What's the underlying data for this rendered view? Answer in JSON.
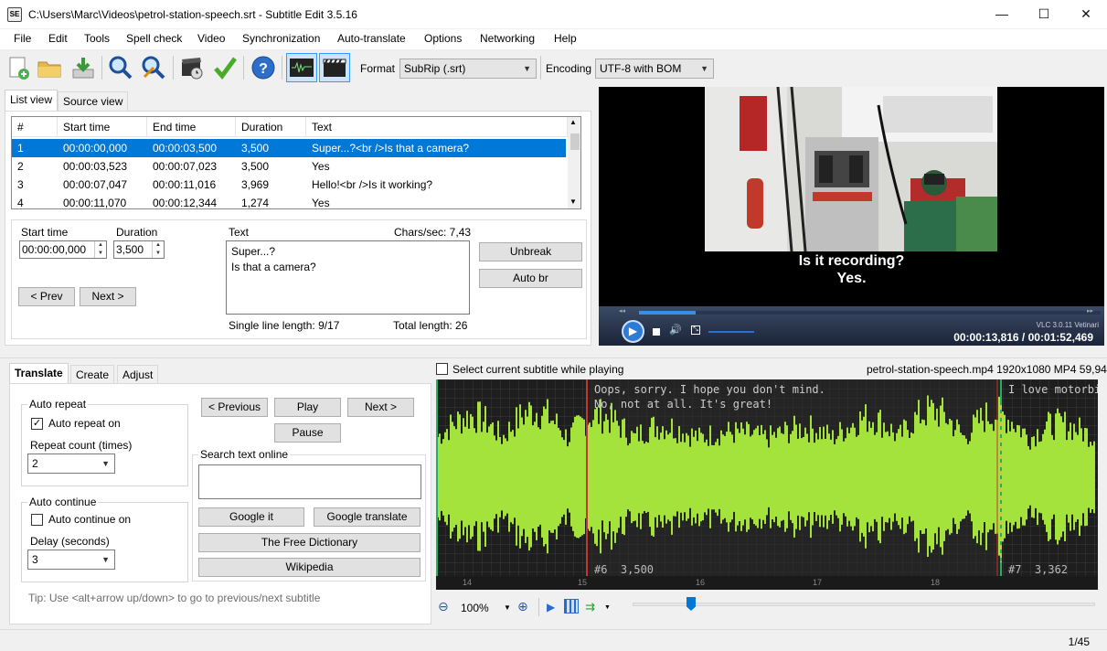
{
  "window": {
    "title": "C:\\Users\\Marc\\Videos\\petrol-station-speech.srt - Subtitle Edit 3.5.16",
    "minimize": "—",
    "maximize": "☐",
    "close": "✕"
  },
  "menu": [
    "File",
    "Edit",
    "Tools",
    "Spell check",
    "Video",
    "Synchronization",
    "Auto-translate",
    "Options",
    "Networking",
    "Help"
  ],
  "toolbar": {
    "icons": [
      "new-file-icon",
      "open-folder-icon",
      "download-icon",
      "find-icon",
      "replace-icon",
      "visual-sync-icon",
      "spell-check-icon",
      "help-icon",
      "waveform-icon",
      "video-icon"
    ],
    "format_label": "Format",
    "format_value": "SubRip (.srt)",
    "encoding_label": "Encoding",
    "encoding_value": "UTF-8 with BOM"
  },
  "view_tabs": {
    "list": "List view",
    "source": "Source view"
  },
  "subtitle_list": {
    "headers": [
      "#",
      "Start time",
      "End time",
      "Duration",
      "Text"
    ],
    "rows": [
      {
        "n": "1",
        "start": "00:00:00,000",
        "end": "00:00:03,500",
        "dur": "3,500",
        "text": "Super...?<br />Is that a camera?"
      },
      {
        "n": "2",
        "start": "00:00:03,523",
        "end": "00:00:07,023",
        "dur": "3,500",
        "text": "Yes"
      },
      {
        "n": "3",
        "start": "00:00:07,047",
        "end": "00:00:11,016",
        "dur": "3,969",
        "text": "Hello!<br />Is it working?"
      },
      {
        "n": "4",
        "start": "00:00:11,070",
        "end": "00:00:12,344",
        "dur": "1,274",
        "text": "Yes"
      }
    ]
  },
  "editor": {
    "start_label": "Start time",
    "start_value": "00:00:00,000",
    "duration_label": "Duration",
    "duration_value": "3,500",
    "text_label": "Text",
    "chars_sec": "Chars/sec: 7,43",
    "text_line1": "Super...?",
    "text_line2": "Is that a camera?",
    "prev": "< Prev",
    "next": "Next >",
    "unbreak": "Unbreak",
    "auto_br": "Auto br",
    "single_line": "Single line length: 9/17",
    "total_length": "Total length: 26"
  },
  "video": {
    "subtitle_line1": "Is it recording?",
    "subtitle_line2": "Yes.",
    "vlc": "VLC 3.0.11 Vetinari",
    "time": "00:00:13,816 / 00:01:52,469"
  },
  "bottom_tabs": {
    "translate": "Translate",
    "create": "Create",
    "adjust": "Adjust"
  },
  "translate": {
    "auto_repeat_title": "Auto repeat",
    "auto_repeat_on": "Auto repeat on",
    "repeat_count_label": "Repeat count (times)",
    "repeat_count": "2",
    "auto_continue_title": "Auto continue",
    "auto_continue_on": "Auto continue on",
    "delay_label": "Delay (seconds)",
    "delay": "3",
    "previous": "< Previous",
    "play": "Play",
    "next": "Next >",
    "pause": "Pause",
    "search_title": "Search text online",
    "google_it": "Google it",
    "google_translate": "Google translate",
    "free_dictionary": "The Free Dictionary",
    "wikipedia": "Wikipedia",
    "tip": "Tip: Use <alt+arrow up/down> to go to previous/next subtitle"
  },
  "waveform": {
    "select_current": "Select current subtitle while playing",
    "media_info": "petrol-station-speech.mp4 1920x1080 MP4 59,94",
    "text_a1": "Oops, sorry. I hope you don't mind.",
    "text_a2": "No, not at all. It's great!",
    "text_b": "I love motorbike",
    "label_6": "#6  3,500",
    "label_7": "#7  3,362",
    "ticks": [
      "14",
      "15",
      "16",
      "17",
      "18"
    ],
    "zoom": "100%"
  },
  "status": {
    "position": "1/45"
  }
}
